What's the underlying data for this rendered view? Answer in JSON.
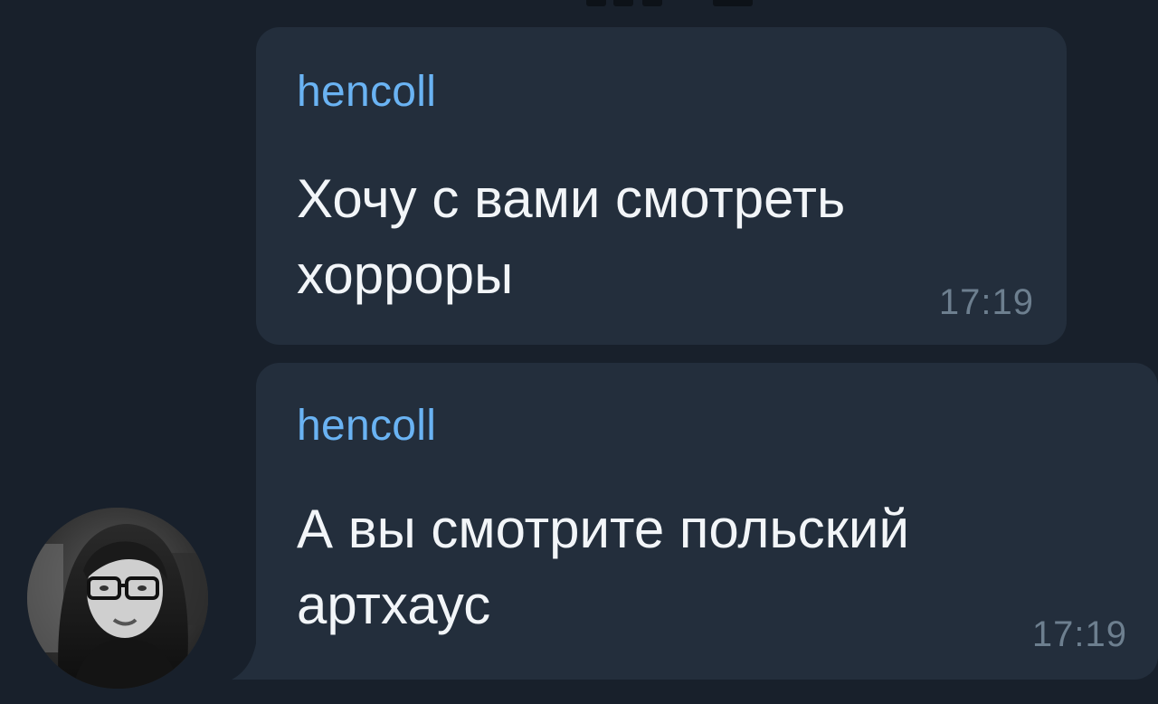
{
  "messages": [
    {
      "sender": "hencoll",
      "text": "Хочу с вами смотреть\nхорроры",
      "time": "17:19"
    },
    {
      "sender": "hencoll",
      "text": "А вы смотрите польский\nартхаус",
      "time": "17:19"
    }
  ],
  "colors": {
    "background": "#18202b",
    "bubble": "#232e3c",
    "sender_name": "#6ab3f3",
    "message_text": "#f2f5f8",
    "timestamp": "#6d7f8f"
  },
  "avatar": {
    "icon": "user-photo-avatar"
  }
}
